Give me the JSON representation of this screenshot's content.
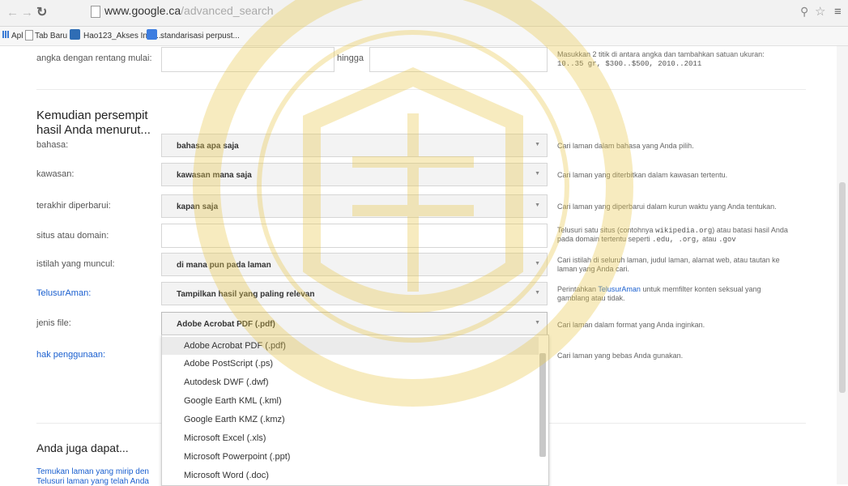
{
  "browser": {
    "url_host": "www.google.ca",
    "url_path": "/advanced_search",
    "bookmarks": [
      {
        "label": "Apl"
      },
      {
        "label": "Tab Baru"
      },
      {
        "label": "Hao123_Akses Inter..."
      },
      {
        "label": "standarisasi perpust..."
      }
    ]
  },
  "range_row": {
    "label": "angka dengan rentang mulai:",
    "to_label": "hingga",
    "help_line1": "Masukkan 2 titik di antara angka dan tambahkan satuan ukuran:",
    "help_line2": "10..35 gr, $300..$500, 2010..2011"
  },
  "narrow_section": {
    "heading_line1": "Kemudian persempit",
    "heading_line2": "hasil Anda menurut..."
  },
  "rows": {
    "language": {
      "label": "bahasa:",
      "value": "bahasa apa saja",
      "help": "Cari laman dalam bahasa yang Anda pilih."
    },
    "region": {
      "label": "kawasan:",
      "value": "kawasan mana saja",
      "help": "Cari laman yang diterbitkan dalam kawasan tertentu."
    },
    "last_update": {
      "label": "terakhir diperbarui:",
      "value": "kapan saja",
      "help": "Cari laman yang diperbarui dalam kurun waktu yang Anda tentukan."
    },
    "site": {
      "label": "situs atau domain:",
      "help_pre": "Telusuri satu situs (contohnya",
      "help_code": "wikipedia.org",
      "help_mid": ") atau batasi hasil Anda",
      "help_line2_pre": "pada domain tertentu seperti",
      "help_line2_code": ".edu, .org,",
      "help_line2_mid": "atau",
      "help_line2_code2": ".gov"
    },
    "terms": {
      "label": "istilah yang muncul:",
      "value": "di mana pun pada laman",
      "help_line1": "Cari istilah di seluruh laman, judul laman, alamat web, atau tautan ke",
      "help_line2": "laman yang Anda cari."
    },
    "safesearch": {
      "label": "TelusurAman:",
      "value": "Tampilkan hasil yang paling relevan",
      "help_pre": "Perintahkan",
      "help_link": "TelusurAman",
      "help_post": "untuk memfilter konten seksual yang",
      "help_line2": "gamblang atau tidak."
    },
    "filetype": {
      "label": "jenis file:",
      "value": "Adobe Acrobat PDF (.pdf)",
      "help": "Cari laman dalam format yang Anda inginkan."
    },
    "usage": {
      "label": "hak penggunaan:",
      "help": "Cari laman yang bebas Anda gunakan."
    }
  },
  "filetype_options": [
    "Adobe Acrobat PDF (.pdf)",
    "Adobe PostScript (.ps)",
    "Autodesk DWF (.dwf)",
    "Google Earth KML (.kml)",
    "Google Earth KMZ (.kmz)",
    "Microsoft Excel (.xls)",
    "Microsoft Powerpoint (.ppt)",
    "Microsoft Word (.doc)"
  ],
  "also_section": {
    "heading": "Anda juga dapat...",
    "link1": "Temukan laman yang mirip den",
    "link2": "Telusuri laman yang telah Anda"
  },
  "colors": {
    "link": "#1a5fcf",
    "watermark": "#e9c84a"
  }
}
